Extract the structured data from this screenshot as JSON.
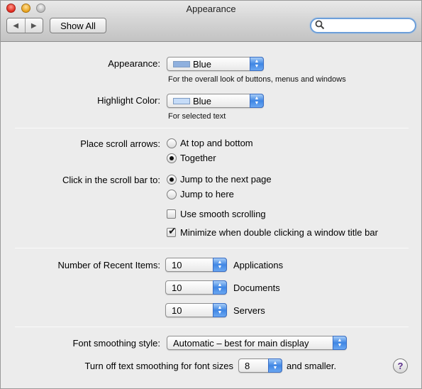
{
  "window": {
    "title": "Appearance"
  },
  "toolbar": {
    "back_icon": "left-arrow",
    "forward_icon": "right-arrow",
    "show_all_label": "Show All",
    "search_value": ""
  },
  "appearance": {
    "label": "Appearance:",
    "value": "Blue",
    "swatch_color": "#8fb0de",
    "help": "For the overall look of buttons, menus and windows"
  },
  "highlight": {
    "label": "Highlight Color:",
    "value": "Blue",
    "swatch_color": "#c6dcf8",
    "help": "For selected text"
  },
  "scroll_arrows": {
    "label": "Place scroll arrows:",
    "options": [
      {
        "label": "At top and bottom",
        "selected": false
      },
      {
        "label": "Together",
        "selected": true
      }
    ]
  },
  "scroll_bar_click": {
    "label": "Click in the scroll bar to:",
    "options": [
      {
        "label": "Jump to the next page",
        "selected": true
      },
      {
        "label": "Jump to here",
        "selected": false
      }
    ]
  },
  "checkboxes": [
    {
      "label": "Use smooth scrolling",
      "checked": false
    },
    {
      "label": "Minimize when double clicking a window title bar",
      "checked": true
    }
  ],
  "recent_items": {
    "label": "Number of Recent Items:",
    "rows": [
      {
        "value": "10",
        "suffix": "Applications"
      },
      {
        "value": "10",
        "suffix": "Documents"
      },
      {
        "value": "10",
        "suffix": "Servers"
      }
    ]
  },
  "font_smoothing": {
    "label": "Font smoothing style:",
    "value": "Automatic – best for main display"
  },
  "text_smoothing_off": {
    "label": "Turn off text smoothing for font sizes",
    "value": "8",
    "suffix": "and smaller."
  },
  "help_button": {
    "label": "?"
  },
  "colors": {
    "accent": "#3f86e4"
  }
}
